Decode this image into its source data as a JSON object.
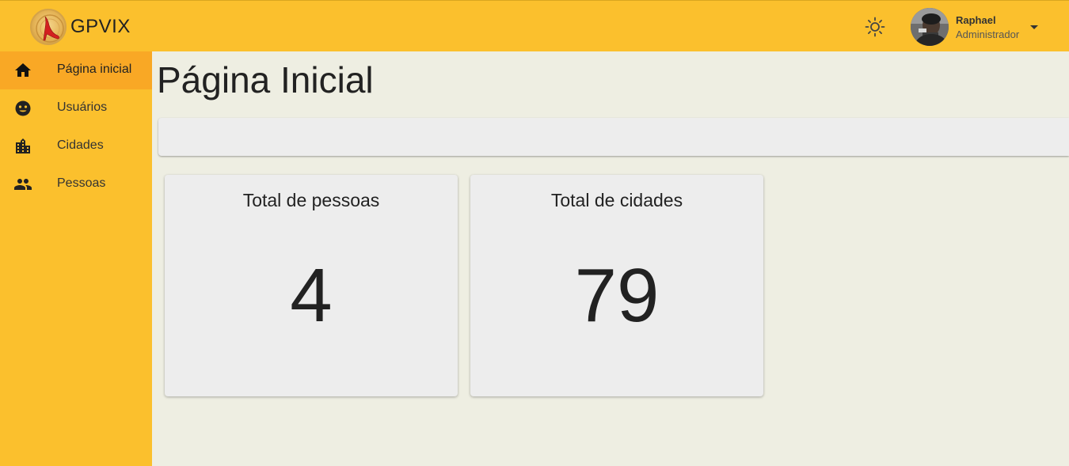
{
  "header": {
    "brand": "GPVIX",
    "user": {
      "name": "Raphael",
      "role": "Administrador"
    },
    "icons": {
      "logo": "heel-shoe-logo",
      "theme": "sun-icon",
      "menu": "caret-down-icon"
    }
  },
  "colors": {
    "primary": "#fbc02d",
    "active": "#f9a825",
    "background": "#eeeee2",
    "card": "#ededed",
    "text": "#222222"
  },
  "sidebar": {
    "items": [
      {
        "label": "Página inicial",
        "icon": "home-icon",
        "active": true
      },
      {
        "label": "Usuários",
        "icon": "face-icon",
        "active": false
      },
      {
        "label": "Cidades",
        "icon": "city-icon",
        "active": false
      },
      {
        "label": "Pessoas",
        "icon": "people-icon",
        "active": false
      }
    ]
  },
  "main": {
    "title": "Página Inicial",
    "cards": [
      {
        "title": "Total de pessoas",
        "value": "4"
      },
      {
        "title": "Total de cidades",
        "value": "79"
      }
    ]
  }
}
